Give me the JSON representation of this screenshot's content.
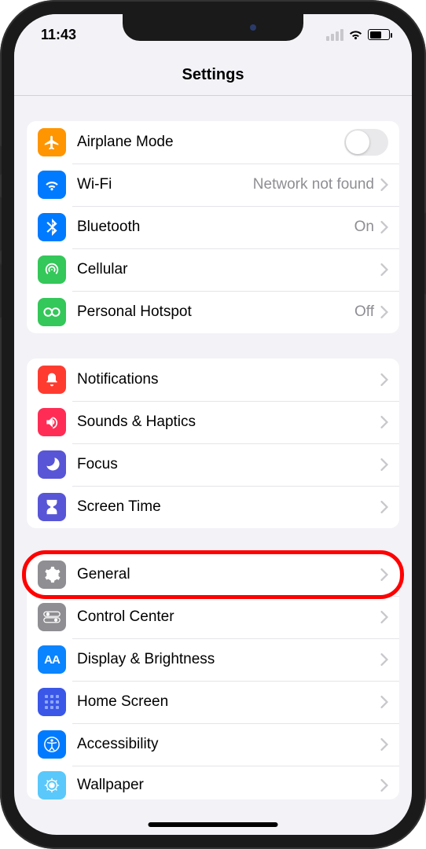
{
  "status": {
    "time": "11:43"
  },
  "nav": {
    "title": "Settings"
  },
  "group1": {
    "airplane": {
      "label": "Airplane Mode"
    },
    "wifi": {
      "label": "Wi-Fi",
      "detail": "Network not found"
    },
    "bluetooth": {
      "label": "Bluetooth",
      "detail": "On"
    },
    "cellular": {
      "label": "Cellular"
    },
    "hotspot": {
      "label": "Personal Hotspot",
      "detail": "Off"
    }
  },
  "group2": {
    "notifications": {
      "label": "Notifications"
    },
    "sounds": {
      "label": "Sounds & Haptics"
    },
    "focus": {
      "label": "Focus"
    },
    "screentime": {
      "label": "Screen Time"
    }
  },
  "group3": {
    "general": {
      "label": "General"
    },
    "controlcenter": {
      "label": "Control Center"
    },
    "display": {
      "label": "Display & Brightness"
    },
    "homescreen": {
      "label": "Home Screen"
    },
    "accessibility": {
      "label": "Accessibility"
    },
    "wallpaper": {
      "label": "Wallpaper"
    }
  },
  "highlighted_row": "general"
}
